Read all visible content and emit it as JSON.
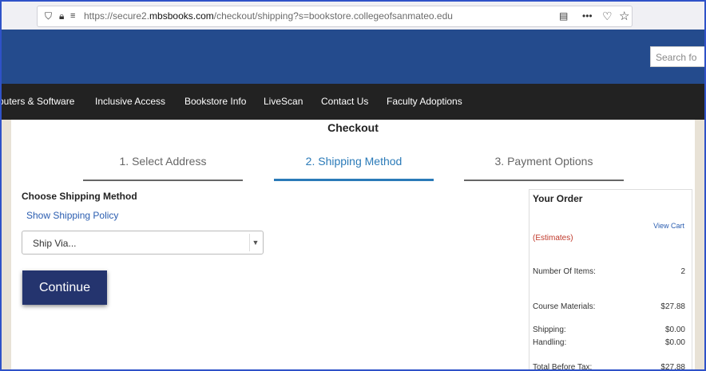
{
  "browser": {
    "url_prefix": "https://secure2.",
    "url_domain": "mbsbooks.com",
    "url_rest": "/checkout/shipping?s=bookstore.collegeofsanmateo.edu"
  },
  "header": {
    "search_placeholder": "Search fo"
  },
  "nav": {
    "items": [
      "puters & Software",
      "Inclusive Access",
      "Bookstore Info",
      "LiveScan",
      "Contact Us",
      "Faculty Adoptions"
    ]
  },
  "checkout": {
    "title": "Checkout",
    "steps": [
      "1. Select Address",
      "2. Shipping Method",
      "3. Payment Options"
    ],
    "active_step": 1
  },
  "shipping": {
    "heading": "Choose Shipping Method",
    "policy_link": "Show Shipping Policy",
    "select_value": "Ship Via...",
    "continue_label": "Continue"
  },
  "order": {
    "title": "Your Order",
    "view_cart": "View Cart",
    "estimates": "(Estimates)",
    "rows": [
      {
        "label": "Number Of Items:",
        "value": "2"
      },
      {
        "label": "Course Materials:",
        "value": "$27.88"
      },
      {
        "label": "Shipping:",
        "value": "$0.00"
      },
      {
        "label": "Handling:",
        "value": "$0.00"
      },
      {
        "label": "Total Before Tax:",
        "value": "$27.88"
      }
    ]
  },
  "colors": {
    "header": "#244b8d",
    "nav": "#222222",
    "accent": "#2a7ab8",
    "button": "#24346e",
    "estimates": "#c0392b"
  },
  "icons": [
    "shield-icon",
    "lock-icon",
    "permissions-icon",
    "reader-icon",
    "more-icon",
    "pocket-icon",
    "bookmark-star-icon",
    "chevron-down-icon"
  ]
}
